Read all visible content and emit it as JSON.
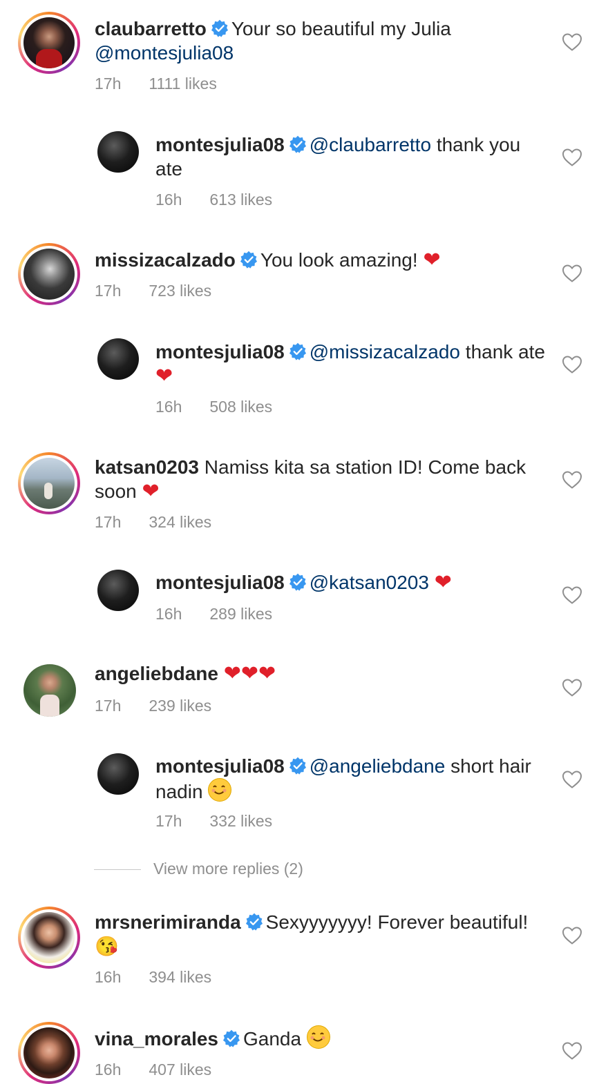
{
  "verified_icon": "verified-badge-icon",
  "like_icon": "heart-outline-icon",
  "comments": [
    {
      "username": "claubarretto",
      "verified": true,
      "text_before": "Your so beautiful my Julia",
      "mention": "@montesjulia08",
      "text_after": "",
      "time": "17h",
      "likes": "1111 likes",
      "replies": [
        {
          "username": "montesjulia08",
          "verified": true,
          "mention": "@claubarretto",
          "text": "thank you ate",
          "time": "16h",
          "likes": "613 likes"
        }
      ]
    },
    {
      "username": "missizacalzado",
      "verified": true,
      "text": "You look amazing!",
      "emoji": "heart",
      "time": "17h",
      "likes": "723 likes",
      "replies": [
        {
          "username": "montesjulia08",
          "verified": true,
          "mention": "@missizacalzado",
          "text": "thank ate",
          "emoji": "heart",
          "time": "16h",
          "likes": "508 likes"
        }
      ]
    },
    {
      "username": "katsan0203",
      "verified": false,
      "text": "Namiss kita sa station ID! Come back soon",
      "emoji": "heart",
      "time": "17h",
      "likes": "324 likes",
      "replies": [
        {
          "username": "montesjulia08",
          "verified": true,
          "mention": "@katsan0203",
          "text": "",
          "emoji": "heart",
          "time": "16h",
          "likes": "289 likes"
        }
      ]
    },
    {
      "username": "angeliebdane",
      "verified": false,
      "text": "",
      "emoji": "three-hearts",
      "time": "17h",
      "likes": "239 likes",
      "replies": [
        {
          "username": "montesjulia08",
          "verified": true,
          "mention": "@angeliebdane",
          "text": "short hair nadin",
          "emoji": "smiling-face",
          "time": "17h",
          "likes": "332 likes"
        }
      ],
      "view_more": "View more replies (2)"
    },
    {
      "username": "mrsnerimiranda",
      "verified": true,
      "text": "Sexyyyyyyy! Forever beautiful!",
      "emoji": "face-blowing-kiss",
      "time": "16h",
      "likes": "394 likes"
    },
    {
      "username": "vina_morales",
      "verified": true,
      "text": "Ganda",
      "emoji": "smiling-face",
      "time": "16h",
      "likes": "407 likes"
    }
  ],
  "heart_glyph": "❤",
  "three_hearts": "❤❤❤",
  "kiss_glyph": "😘"
}
